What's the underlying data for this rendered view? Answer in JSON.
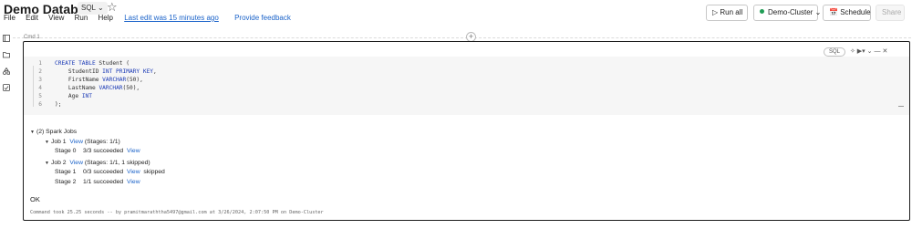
{
  "header": {
    "notebook_title": "Demo Databricks",
    "language": "SQL",
    "star_glyph": "☆",
    "menu": [
      "File",
      "Edit",
      "View",
      "Run",
      "Help"
    ],
    "last_edit": "Last edit was 15 minutes ago",
    "feedback": "Provide feedback"
  },
  "toolbar": {
    "run_all": "Run all",
    "cluster": "Demo-Cluster",
    "schedule": "Schedule",
    "share": "Share"
  },
  "rail_icons": [
    "notebook-icon",
    "folder-icon",
    "shapes-icon",
    "experiments-icon"
  ],
  "cell": {
    "cmd_label": "Cmd 1",
    "lang_pill": "SQL",
    "code_lines": [
      {
        "n": "1",
        "parts": [
          {
            "t": "CREATE TABLE",
            "kw": true
          },
          {
            "t": " Student (",
            "kw": false
          }
        ]
      },
      {
        "n": "2",
        "parts": [
          {
            "t": "    StudentID ",
            "kw": false
          },
          {
            "t": "INT PRIMARY KEY",
            "kw": true
          },
          {
            "t": ",",
            "kw": false
          }
        ]
      },
      {
        "n": "3",
        "parts": [
          {
            "t": "    FirstName ",
            "kw": false
          },
          {
            "t": "VARCHAR",
            "kw": true
          },
          {
            "t": "(50),",
            "kw": false
          }
        ]
      },
      {
        "n": "4",
        "parts": [
          {
            "t": "    LastName ",
            "kw": false
          },
          {
            "t": "VARCHAR",
            "kw": true
          },
          {
            "t": "(50),",
            "kw": false
          }
        ]
      },
      {
        "n": "5",
        "parts": [
          {
            "t": "    Age ",
            "kw": false
          },
          {
            "t": "INT",
            "kw": true
          }
        ]
      },
      {
        "n": "6",
        "parts": [
          {
            "t": ");",
            "kw": false
          }
        ]
      }
    ]
  },
  "output": {
    "spark_jobs": "(2) Spark Jobs",
    "job1": {
      "label": "Job 1",
      "view": "View",
      "stages": "(Stages: 1/1)"
    },
    "job1_stage0": {
      "label": "Stage 0",
      "status": "3/3 succeeded",
      "view": "View"
    },
    "job2": {
      "label": "Job 2",
      "view": "View",
      "stages": "(Stages: 1/1, 1 skipped)"
    },
    "job2_stage1": {
      "label": "Stage 1",
      "status": "0/3 succeeded",
      "view": "View",
      "note": "skipped"
    },
    "job2_stage2": {
      "label": "Stage 2",
      "status": "1/1 succeeded",
      "view": "View"
    },
    "result": "OK",
    "command_took": "Command took 25.25 seconds -- by pramitmaraththa5497@gmail.com at 3/26/2024, 2:07:50 PM on Demo-Cluster"
  },
  "colors": {
    "link": "#1b63c9",
    "keyword": "#1a39b5",
    "status_green": "#1f9d55"
  }
}
